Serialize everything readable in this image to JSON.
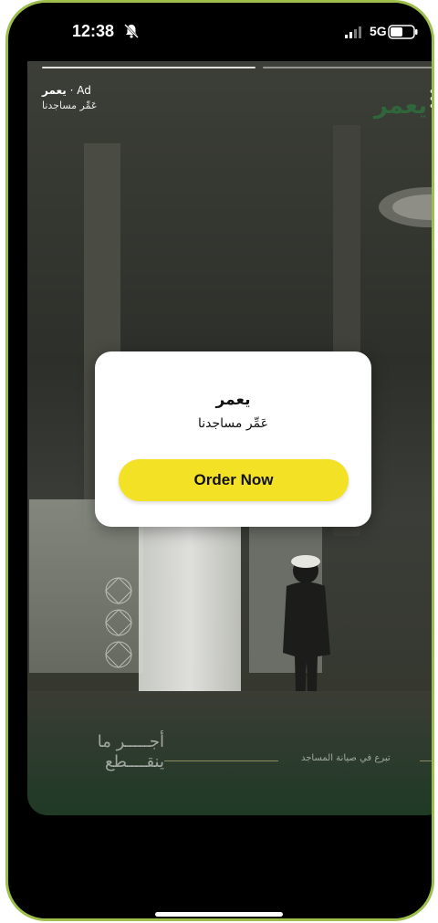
{
  "status": {
    "time": "12:38",
    "network": "5G"
  },
  "story": {
    "ad_label": "Ad",
    "separator": "·",
    "brand_name": "يعمر",
    "subtitle": "عَمِّر مساجدنا",
    "logo_text": "يعمر",
    "bottom_left_text": "أجـــــر ما ينقــــطع",
    "bottom_right_text": "تبرع في صيانة المساجد"
  },
  "card": {
    "title": "يعمر",
    "subtitle": "عَمِّر مساجدنا",
    "cta_label": "Order Now"
  },
  "colors": {
    "cta": "#f2e124",
    "frame": "#9dbe4a",
    "logo": "#2f6e3c"
  }
}
